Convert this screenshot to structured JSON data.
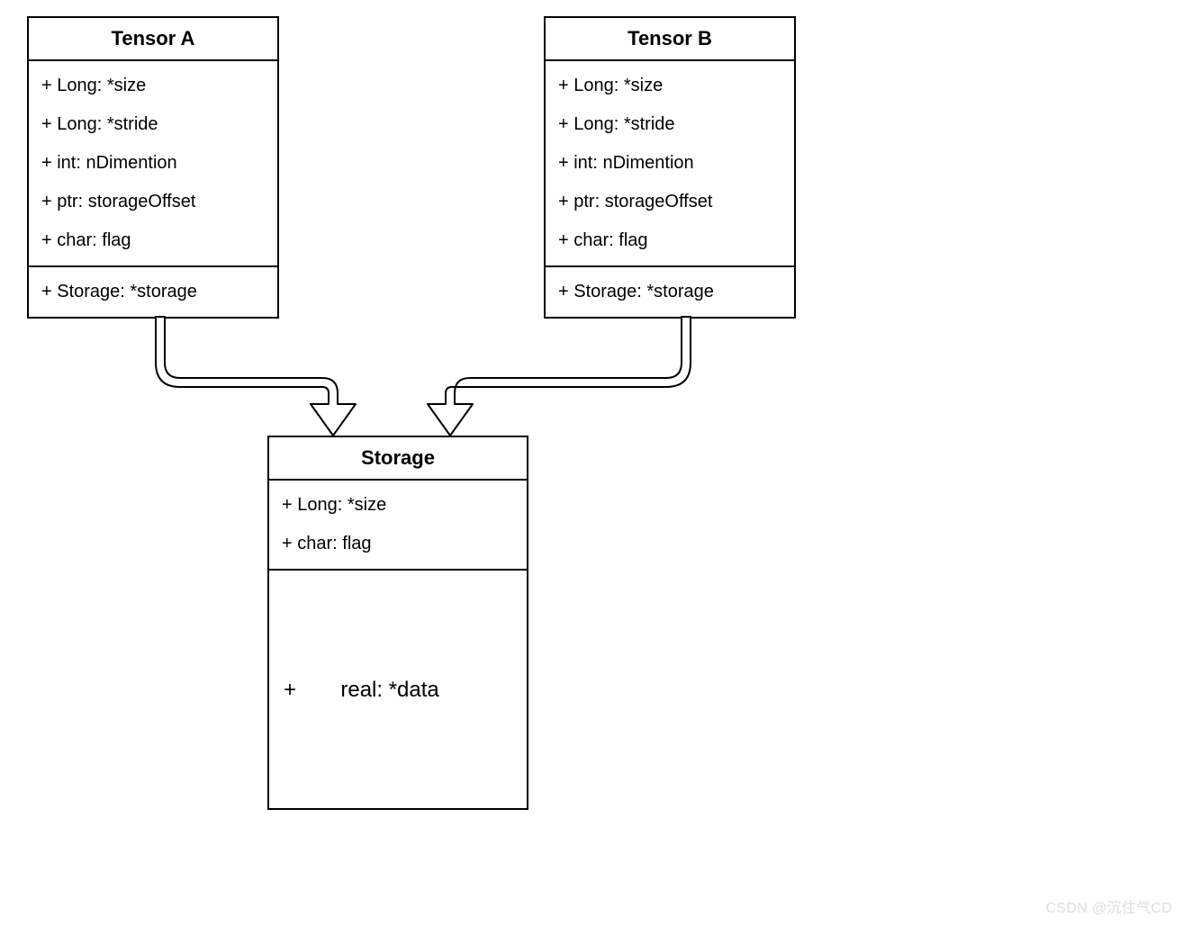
{
  "tensorA": {
    "title": "Tensor A",
    "attrs": [
      "+ Long: *size",
      "+ Long: *stride",
      "+ int:  nDimention",
      "+ ptr: storageOffset",
      "+ char: flag"
    ],
    "tail": "+ Storage: *storage"
  },
  "tensorB": {
    "title": "Tensor B",
    "attrs": [
      "+ Long: *size",
      "+ Long: *stride",
      "+ int:  nDimention",
      "+ ptr: storageOffset",
      "+ char: flag"
    ],
    "tail": "+ Storage: *storage"
  },
  "storage": {
    "title": "Storage",
    "attrs": [
      "+ Long: *size",
      "+ char: flag"
    ],
    "data_prefix": "+",
    "data_label": "real: *data"
  },
  "watermark": "CSDN @沉住气CD"
}
